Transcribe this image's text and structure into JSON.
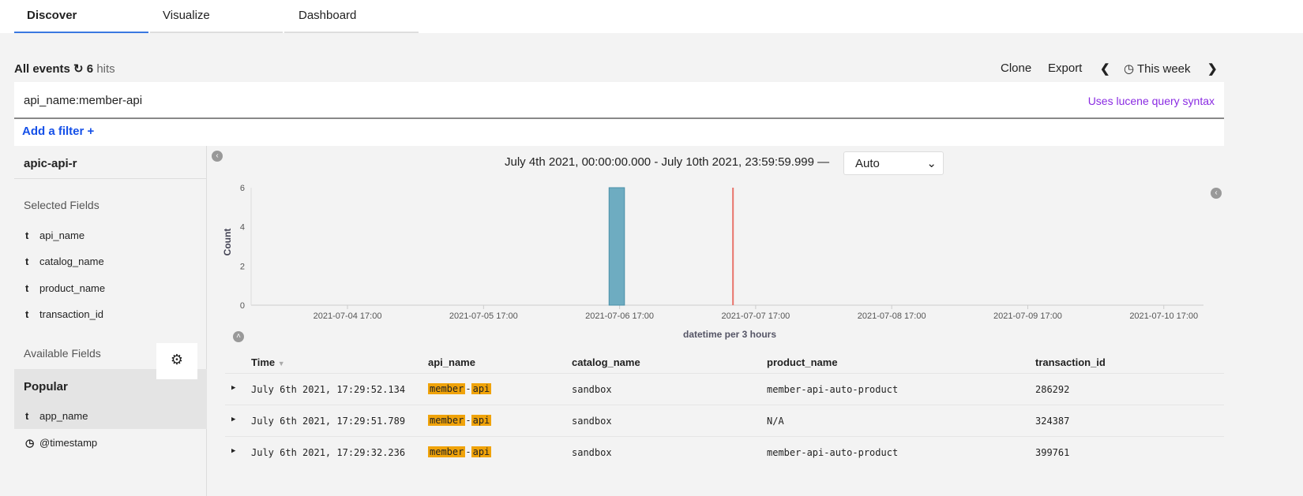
{
  "tabs": [
    {
      "label": "Discover",
      "active": true
    },
    {
      "label": "Visualize"
    },
    {
      "label": "Dashboard"
    }
  ],
  "toolbar": {
    "title": "All events",
    "refresh_icon": "refresh-icon",
    "hits_count": "6",
    "hits_label": "hits",
    "clone": "Clone",
    "export": "Export",
    "prev_icon": "chevron-left-icon",
    "time_label": "This week",
    "next_icon": "chevron-right-icon"
  },
  "query": {
    "value": "api_name:member-api",
    "hint": "Uses lucene query syntax"
  },
  "filter": {
    "add_label": "Add a filter",
    "plus": "+"
  },
  "sidebar": {
    "index": "apic-api-r",
    "selected_title": "Selected Fields",
    "selected": [
      {
        "type": "t",
        "name": "api_name"
      },
      {
        "type": "t",
        "name": "catalog_name"
      },
      {
        "type": "t",
        "name": "product_name"
      },
      {
        "type": "t",
        "name": "transaction_id"
      }
    ],
    "available_title": "Available Fields",
    "popular_title": "Popular",
    "popular": [
      {
        "type": "t",
        "name": "app_name"
      }
    ],
    "other": [
      {
        "type": "clock",
        "name": "@timestamp"
      }
    ]
  },
  "chart_header": {
    "range": "July 4th 2021, 00:00:00.000 - July 10th 2021, 23:59:59.999 —",
    "interval": "Auto"
  },
  "chart_data": {
    "type": "bar",
    "xlabel": "datetime per 3 hours",
    "ylabel": "Count",
    "x_ticks": [
      "2021-07-04 17:00",
      "2021-07-05 17:00",
      "2021-07-06 17:00",
      "2021-07-07 17:00",
      "2021-07-08 17:00",
      "2021-07-09 17:00",
      "2021-07-10 17:00"
    ],
    "y_ticks": [
      "0",
      "2",
      "4",
      "6"
    ],
    "ylim": [
      0,
      6
    ],
    "xlim": [
      "2021-07-04 00:00",
      "2021-07-11 00:00"
    ],
    "bars": [
      {
        "x": "2021-07-06 15:00",
        "value": 6
      }
    ],
    "current_time_marker": "2021-07-07 13:00",
    "bar_color": "#6eacc1",
    "marker_color": "#e8746b"
  },
  "table": {
    "columns": [
      "Time",
      "api_name",
      "catalog_name",
      "product_name",
      "transaction_id"
    ],
    "rows": [
      {
        "time": "July 6th 2021, 17:29:52.134",
        "api_a": "member",
        "api_sep": "-",
        "api_b": "api",
        "catalog": "sandbox",
        "product": "member-api-auto-product",
        "tid": "286292"
      },
      {
        "time": "July 6th 2021, 17:29:51.789",
        "api_a": "member",
        "api_sep": "-",
        "api_b": "api",
        "catalog": "sandbox",
        "product": "N/A",
        "tid": "324387"
      },
      {
        "time": "July 6th 2021, 17:29:32.236",
        "api_a": "member",
        "api_sep": "-",
        "api_b": "api",
        "catalog": "sandbox",
        "product": "member-api-auto-product",
        "tid": "399761"
      }
    ]
  }
}
